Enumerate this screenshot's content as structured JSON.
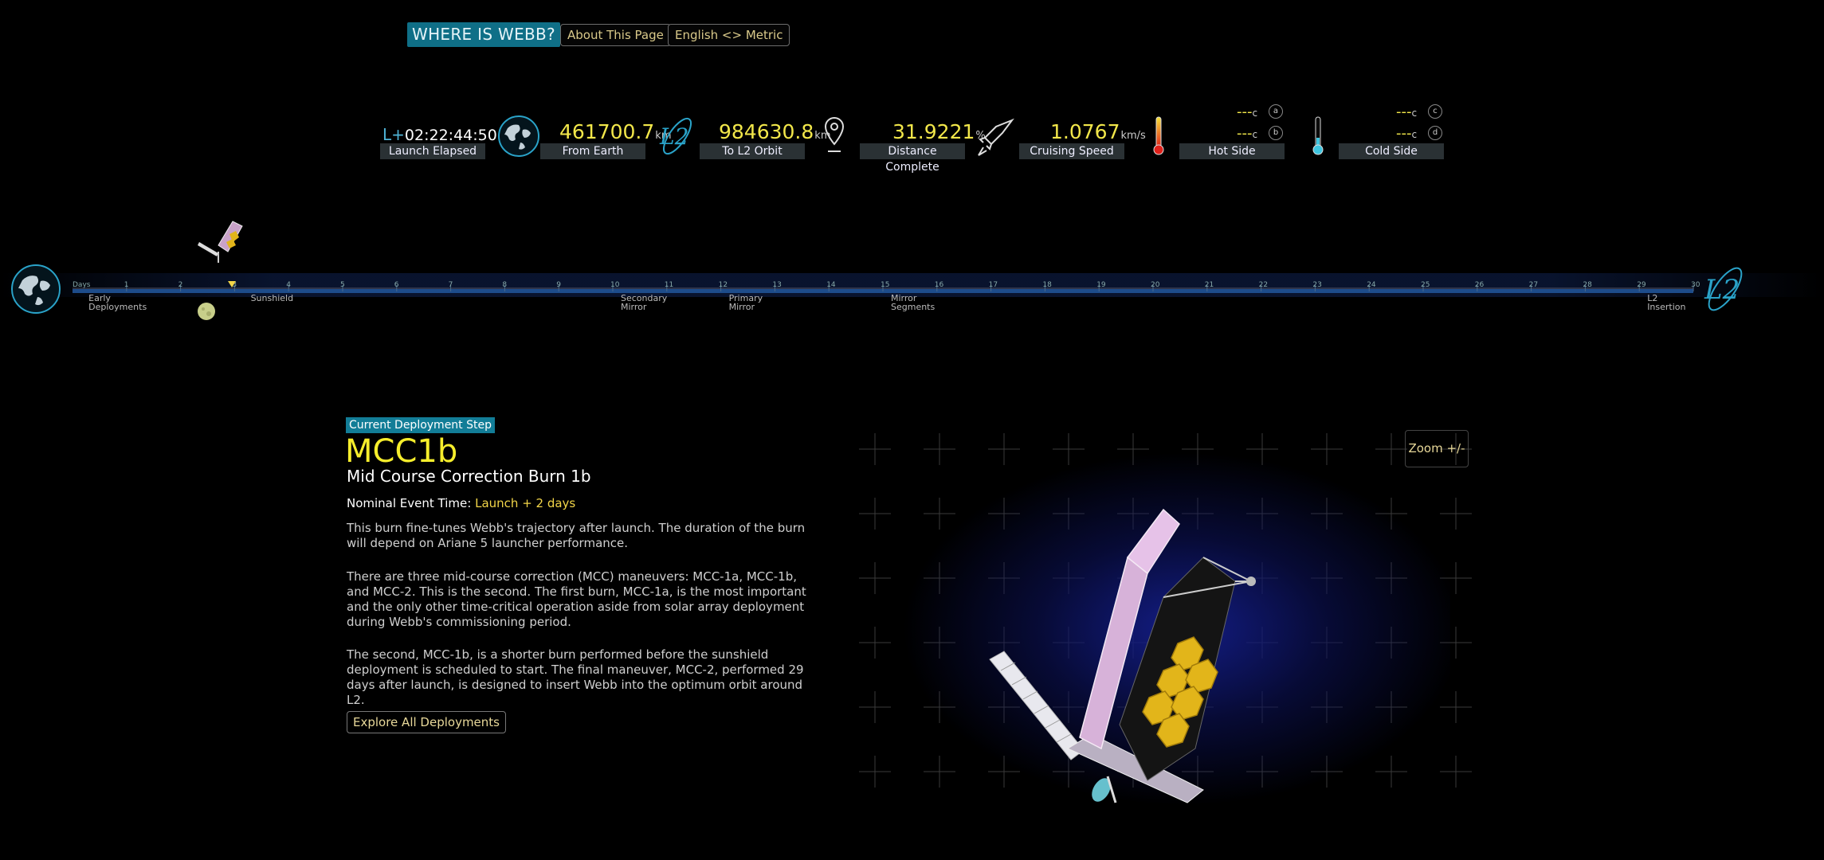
{
  "header": {
    "brand": "WHERE IS WEBB?",
    "about_label": "About This Page",
    "units_label": "English <> Metric"
  },
  "stats": {
    "launch": {
      "prefix": "L+",
      "value": "02:22:44:50",
      "label": "Launch Elapsed"
    },
    "earth": {
      "value": "461700.7",
      "unit": "km",
      "label": "From Earth",
      "icon": "earth-icon"
    },
    "l2": {
      "value": "984630.8",
      "unit": "km",
      "label": "To L2 Orbit",
      "icon": "l2-icon"
    },
    "complete": {
      "value": "31.9221",
      "unit": "%",
      "label": "Distance Complete",
      "icon": "map-pin-icon"
    },
    "speed": {
      "value": "1.0767",
      "unit": "km/s",
      "label": "Cruising Speed",
      "icon": "rocket-icon"
    },
    "hot": {
      "label": "Hot Side",
      "a_value": "---",
      "b_value": "---",
      "unit": "c",
      "a_badge": "a",
      "b_badge": "b",
      "icon": "thermometer-hot-icon"
    },
    "cold": {
      "label": "Cold Side",
      "c_value": "---",
      "d_value": "---",
      "unit": "c",
      "c_badge": "c",
      "d_badge": "d",
      "icon": "thermometer-cold-icon"
    }
  },
  "timeline": {
    "axis_label": "Days",
    "ticks": [
      "1",
      "2",
      "3",
      "4",
      "5",
      "6",
      "7",
      "8",
      "9",
      "10",
      "11",
      "12",
      "13",
      "14",
      "15",
      "16",
      "17",
      "18",
      "19",
      "20",
      "21",
      "22",
      "23",
      "24",
      "25",
      "26",
      "27",
      "28",
      "29",
      "30"
    ],
    "current_day": 2.95,
    "milestones": [
      {
        "day": 0.15,
        "line1": "Early",
        "line2": "Deployments"
      },
      {
        "day": 3.15,
        "line1": "Sunshield",
        "line2": ""
      },
      {
        "day": 10.0,
        "line1": "Secondary",
        "line2": "Mirror"
      },
      {
        "day": 12.0,
        "line1": "Primary",
        "line2": "Mirror"
      },
      {
        "day": 15.0,
        "line1": "Mirror",
        "line2": "Segments"
      },
      {
        "day": 29.0,
        "line1": "L2",
        "line2": "Insertion"
      }
    ],
    "end_label": "L2"
  },
  "step": {
    "tag": "Current Deployment Step",
    "code": "MCC1b",
    "name": "Mid Course Correction Burn 1b",
    "nominal_label": "Nominal Event Time:",
    "nominal_value": "Launch + 2 days",
    "paragraphs": [
      "This burn fine-tunes Webb's trajectory after launch. The duration of the burn will depend on Ariane 5 launcher performance.",
      "There are three mid-course correction (MCC) maneuvers: MCC-1a, MCC-1b, and MCC-2. This is the second. The first burn, MCC-1a, is the most important and the only other time-critical operation aside from solar array deployment during Webb's commissioning period.",
      "The second, MCC-1b, is a shorter burn performed before the sunshield deployment is scheduled to start. The final maneuver, MCC-2, performed 29 days after launch, is designed to insert Webb into the optimum orbit around L2."
    ],
    "explore_label": "Explore All Deployments"
  },
  "viewer": {
    "zoom_label": "Zoom +/-"
  },
  "colors": {
    "accent": "#0f6f87",
    "value_yellow": "#f2e74a",
    "gold": "#e2b51a",
    "track_blue": "#1d4c8a"
  }
}
